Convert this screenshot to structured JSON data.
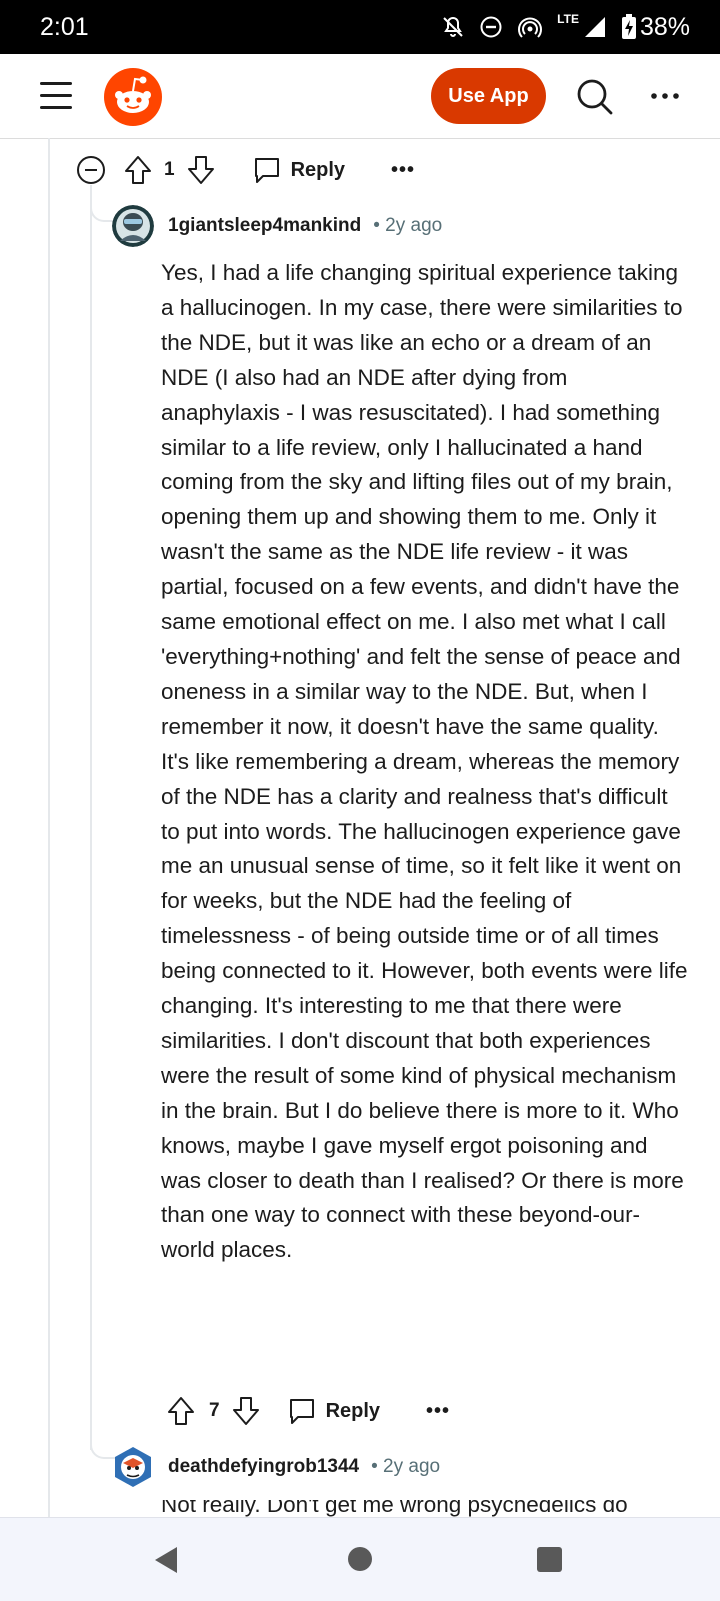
{
  "status_bar": {
    "time": "2:01",
    "network": "LTE",
    "battery": "38%"
  },
  "header": {
    "use_app_label": "Use App"
  },
  "parent_actions": {
    "vote_count": "1",
    "reply_label": "Reply",
    "more_label": "•••"
  },
  "comment": {
    "username": "1giantsleep4mankind",
    "age": "• 2y ago",
    "body": "Yes, I had a life changing spiritual experience taking a hallucinogen. In my case, there were similarities to the NDE, but it was like an echo or a dream of an NDE (I also had an NDE after dying from anaphylaxis - I was resuscitated). I had something similar to a life review, only I hallucinated a hand coming from the sky and lifting files out of my brain, opening them up and showing them to me. Only it wasn't the same as the NDE life review - it was partial, focused on a few events, and didn't have the same emotional effect on me. I also met what I call 'everything+nothing' and felt the sense of peace and oneness in a similar way to the NDE. But, when I remember it now, it doesn't have the same quality. It's like remembering a dream, whereas the memory of the NDE has a clarity and realness that's difficult to put into words. The hallucinogen experience gave me an unusual sense of time, so it felt like it went on for weeks, but the NDE had the feeling of timelessness - of being outside time or of all times being connected to it. However, both events were life changing. It's interesting to me that there were similarities. I don't discount that both experiences were the result of some kind of physical mechanism in the brain. But I do believe there is more to it. Who knows, maybe I gave myself ergot poisoning and was closer to death than I realised? Or there is more than one way to connect with these beyond-our-world places.",
    "vote_count": "7",
    "reply_label": "Reply",
    "more_label": "•••"
  },
  "next_comment": {
    "username": "deathdefyingrob1344",
    "age": "• 2y ago",
    "body_partial": "Not really. Don't get me wrong psychedelics do"
  },
  "icons": {
    "collapse": "collapse-icon",
    "upvote": "upvote-icon",
    "downvote": "downvote-icon",
    "reply": "reply-icon",
    "search": "search-icon",
    "menu": "hamburger-icon"
  },
  "colors": {
    "accent": "#d93900",
    "meta_text": "#576f76"
  }
}
